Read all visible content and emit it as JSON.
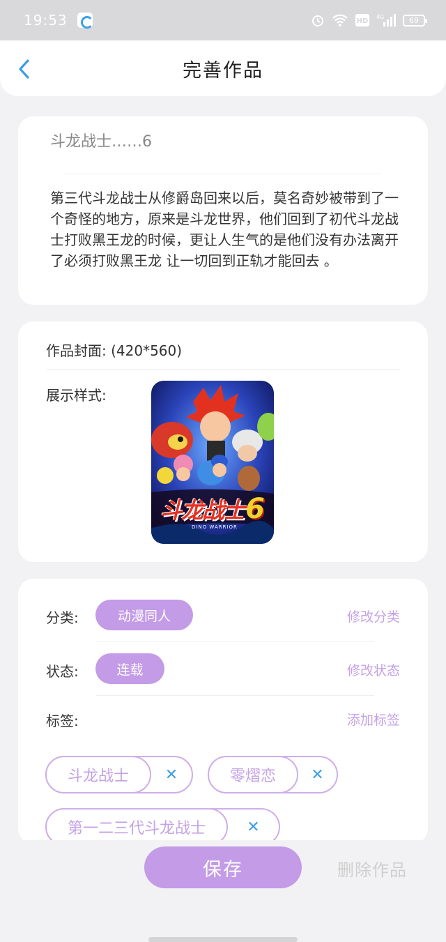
{
  "status_bar": {
    "time": "19:53",
    "battery": "69"
  },
  "header": {
    "title": "完善作品"
  },
  "work": {
    "title": "斗龙战士……6",
    "synopsis": "第三代斗龙战士从修爵岛回来以后，莫名奇妙被带到了一个奇怪的地方，原来是斗龙世界，他们回到了初代斗龙战士打败黑王龙的时候，更让人生气的是他们没有办法离开了必须打败黑王龙 让一切回到正轨才能回去 。"
  },
  "cover": {
    "label": "作品封面: (420*560)",
    "display_label": "展示样式:",
    "logo_text": "斗龙战士",
    "logo_number": "6",
    "logo_sub": "DINO WARRIOR"
  },
  "meta": {
    "category_label": "分类:",
    "category_value": "动漫同人",
    "category_link": "修改分类",
    "status_label": "状态:",
    "status_value": "连载",
    "status_link": "修改状态",
    "tags_label": "标签:",
    "tags_link": "添加标签",
    "tags": [
      "斗龙战士",
      "零熠恋",
      "第一二三代斗龙战士"
    ]
  },
  "actions": {
    "save": "保存",
    "delete": "删除作品"
  },
  "colors": {
    "accent": "#c39be6",
    "link": "#c5a2e6",
    "icon_blue": "#3b9ee6"
  }
}
